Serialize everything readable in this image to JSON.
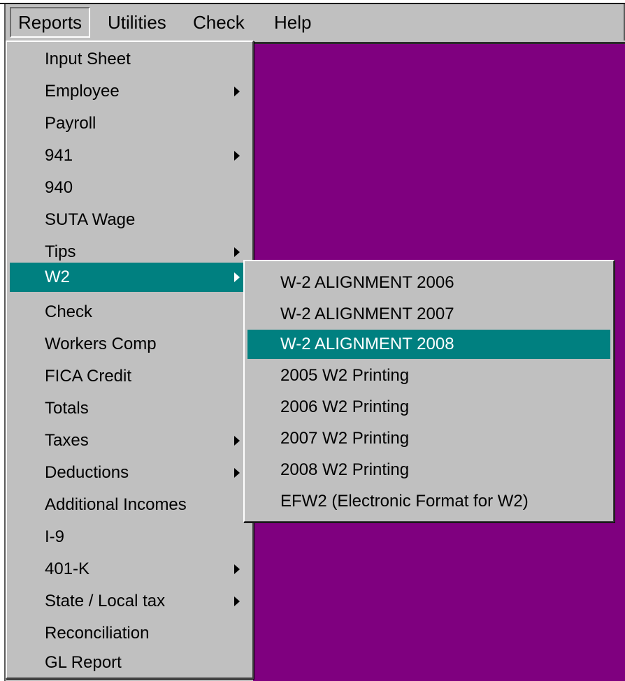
{
  "menubar": {
    "items": [
      {
        "label": "Reports"
      },
      {
        "label": "Utilities"
      },
      {
        "label": "Check"
      },
      {
        "label": "Help"
      }
    ]
  },
  "reports_menu": {
    "items": [
      {
        "label": "Input Sheet",
        "has_submenu": false
      },
      {
        "label": "Employee",
        "has_submenu": true
      },
      {
        "label": "Payroll",
        "has_submenu": false
      },
      {
        "label": "941",
        "has_submenu": true
      },
      {
        "label": "940",
        "has_submenu": false
      },
      {
        "label": "SUTA Wage",
        "has_submenu": false
      },
      {
        "label": "Tips",
        "has_submenu": true
      },
      {
        "label": "W2",
        "has_submenu": true,
        "selected": true
      },
      {
        "label": "Check",
        "has_submenu": false
      },
      {
        "label": "Workers Comp",
        "has_submenu": false
      },
      {
        "label": "FICA Credit",
        "has_submenu": false
      },
      {
        "label": "Totals",
        "has_submenu": false
      },
      {
        "label": "Taxes",
        "has_submenu": true
      },
      {
        "label": "Deductions",
        "has_submenu": true
      },
      {
        "label": "Additional Incomes",
        "has_submenu": false
      },
      {
        "label": "I-9",
        "has_submenu": false
      },
      {
        "label": "401-K",
        "has_submenu": true
      },
      {
        "label": "State / Local tax",
        "has_submenu": true
      },
      {
        "label": "Reconciliation",
        "has_submenu": false
      },
      {
        "label": "GL Report",
        "has_submenu": false
      }
    ]
  },
  "w2_submenu": {
    "items": [
      {
        "label": "W-2 ALIGNMENT 2006"
      },
      {
        "label": "W-2 ALIGNMENT 2007"
      },
      {
        "label": "W-2 ALIGNMENT 2008",
        "selected": true
      },
      {
        "label": "2005 W2 Printing"
      },
      {
        "label": "2006 W2 Printing"
      },
      {
        "label": "2007 W2 Printing"
      },
      {
        "label": "2008 W2 Printing"
      },
      {
        "label": "EFW2 (Electronic Format for W2)"
      }
    ]
  },
  "colors": {
    "menu_bg": "#c0c0c0",
    "highlight": "#008080",
    "desktop": "#7f007f"
  },
  "icons": {
    "submenu_arrow": "chevron-right-icon"
  }
}
